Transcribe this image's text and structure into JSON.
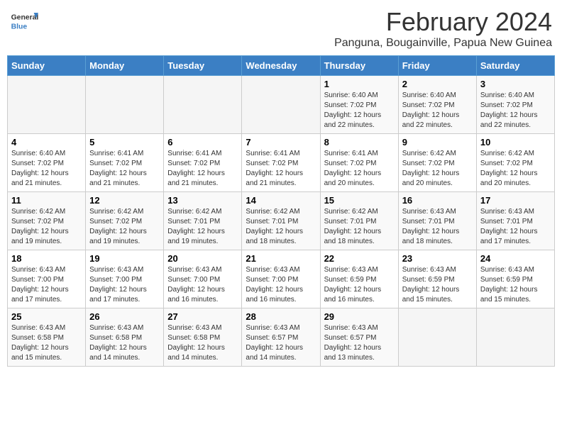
{
  "header": {
    "logo_general": "General",
    "logo_blue": "Blue",
    "main_title": "February 2024",
    "subtitle": "Panguna, Bougainville, Papua New Guinea"
  },
  "days_of_week": [
    "Sunday",
    "Monday",
    "Tuesday",
    "Wednesday",
    "Thursday",
    "Friday",
    "Saturday"
  ],
  "weeks": [
    [
      {
        "day": "",
        "info": ""
      },
      {
        "day": "",
        "info": ""
      },
      {
        "day": "",
        "info": ""
      },
      {
        "day": "",
        "info": ""
      },
      {
        "day": "1",
        "info": "Sunrise: 6:40 AM\nSunset: 7:02 PM\nDaylight: 12 hours and 22 minutes."
      },
      {
        "day": "2",
        "info": "Sunrise: 6:40 AM\nSunset: 7:02 PM\nDaylight: 12 hours and 22 minutes."
      },
      {
        "day": "3",
        "info": "Sunrise: 6:40 AM\nSunset: 7:02 PM\nDaylight: 12 hours and 22 minutes."
      }
    ],
    [
      {
        "day": "4",
        "info": "Sunrise: 6:40 AM\nSunset: 7:02 PM\nDaylight: 12 hours and 21 minutes."
      },
      {
        "day": "5",
        "info": "Sunrise: 6:41 AM\nSunset: 7:02 PM\nDaylight: 12 hours and 21 minutes."
      },
      {
        "day": "6",
        "info": "Sunrise: 6:41 AM\nSunset: 7:02 PM\nDaylight: 12 hours and 21 minutes."
      },
      {
        "day": "7",
        "info": "Sunrise: 6:41 AM\nSunset: 7:02 PM\nDaylight: 12 hours and 21 minutes."
      },
      {
        "day": "8",
        "info": "Sunrise: 6:41 AM\nSunset: 7:02 PM\nDaylight: 12 hours and 20 minutes."
      },
      {
        "day": "9",
        "info": "Sunrise: 6:42 AM\nSunset: 7:02 PM\nDaylight: 12 hours and 20 minutes."
      },
      {
        "day": "10",
        "info": "Sunrise: 6:42 AM\nSunset: 7:02 PM\nDaylight: 12 hours and 20 minutes."
      }
    ],
    [
      {
        "day": "11",
        "info": "Sunrise: 6:42 AM\nSunset: 7:02 PM\nDaylight: 12 hours and 19 minutes."
      },
      {
        "day": "12",
        "info": "Sunrise: 6:42 AM\nSunset: 7:02 PM\nDaylight: 12 hours and 19 minutes."
      },
      {
        "day": "13",
        "info": "Sunrise: 6:42 AM\nSunset: 7:01 PM\nDaylight: 12 hours and 19 minutes."
      },
      {
        "day": "14",
        "info": "Sunrise: 6:42 AM\nSunset: 7:01 PM\nDaylight: 12 hours and 18 minutes."
      },
      {
        "day": "15",
        "info": "Sunrise: 6:42 AM\nSunset: 7:01 PM\nDaylight: 12 hours and 18 minutes."
      },
      {
        "day": "16",
        "info": "Sunrise: 6:43 AM\nSunset: 7:01 PM\nDaylight: 12 hours and 18 minutes."
      },
      {
        "day": "17",
        "info": "Sunrise: 6:43 AM\nSunset: 7:01 PM\nDaylight: 12 hours and 17 minutes."
      }
    ],
    [
      {
        "day": "18",
        "info": "Sunrise: 6:43 AM\nSunset: 7:00 PM\nDaylight: 12 hours and 17 minutes."
      },
      {
        "day": "19",
        "info": "Sunrise: 6:43 AM\nSunset: 7:00 PM\nDaylight: 12 hours and 17 minutes."
      },
      {
        "day": "20",
        "info": "Sunrise: 6:43 AM\nSunset: 7:00 PM\nDaylight: 12 hours and 16 minutes."
      },
      {
        "day": "21",
        "info": "Sunrise: 6:43 AM\nSunset: 7:00 PM\nDaylight: 12 hours and 16 minutes."
      },
      {
        "day": "22",
        "info": "Sunrise: 6:43 AM\nSunset: 6:59 PM\nDaylight: 12 hours and 16 minutes."
      },
      {
        "day": "23",
        "info": "Sunrise: 6:43 AM\nSunset: 6:59 PM\nDaylight: 12 hours and 15 minutes."
      },
      {
        "day": "24",
        "info": "Sunrise: 6:43 AM\nSunset: 6:59 PM\nDaylight: 12 hours and 15 minutes."
      }
    ],
    [
      {
        "day": "25",
        "info": "Sunrise: 6:43 AM\nSunset: 6:58 PM\nDaylight: 12 hours and 15 minutes."
      },
      {
        "day": "26",
        "info": "Sunrise: 6:43 AM\nSunset: 6:58 PM\nDaylight: 12 hours and 14 minutes."
      },
      {
        "day": "27",
        "info": "Sunrise: 6:43 AM\nSunset: 6:58 PM\nDaylight: 12 hours and 14 minutes."
      },
      {
        "day": "28",
        "info": "Sunrise: 6:43 AM\nSunset: 6:57 PM\nDaylight: 12 hours and 14 minutes."
      },
      {
        "day": "29",
        "info": "Sunrise: 6:43 AM\nSunset: 6:57 PM\nDaylight: 12 hours and 13 minutes."
      },
      {
        "day": "",
        "info": ""
      },
      {
        "day": "",
        "info": ""
      }
    ]
  ]
}
